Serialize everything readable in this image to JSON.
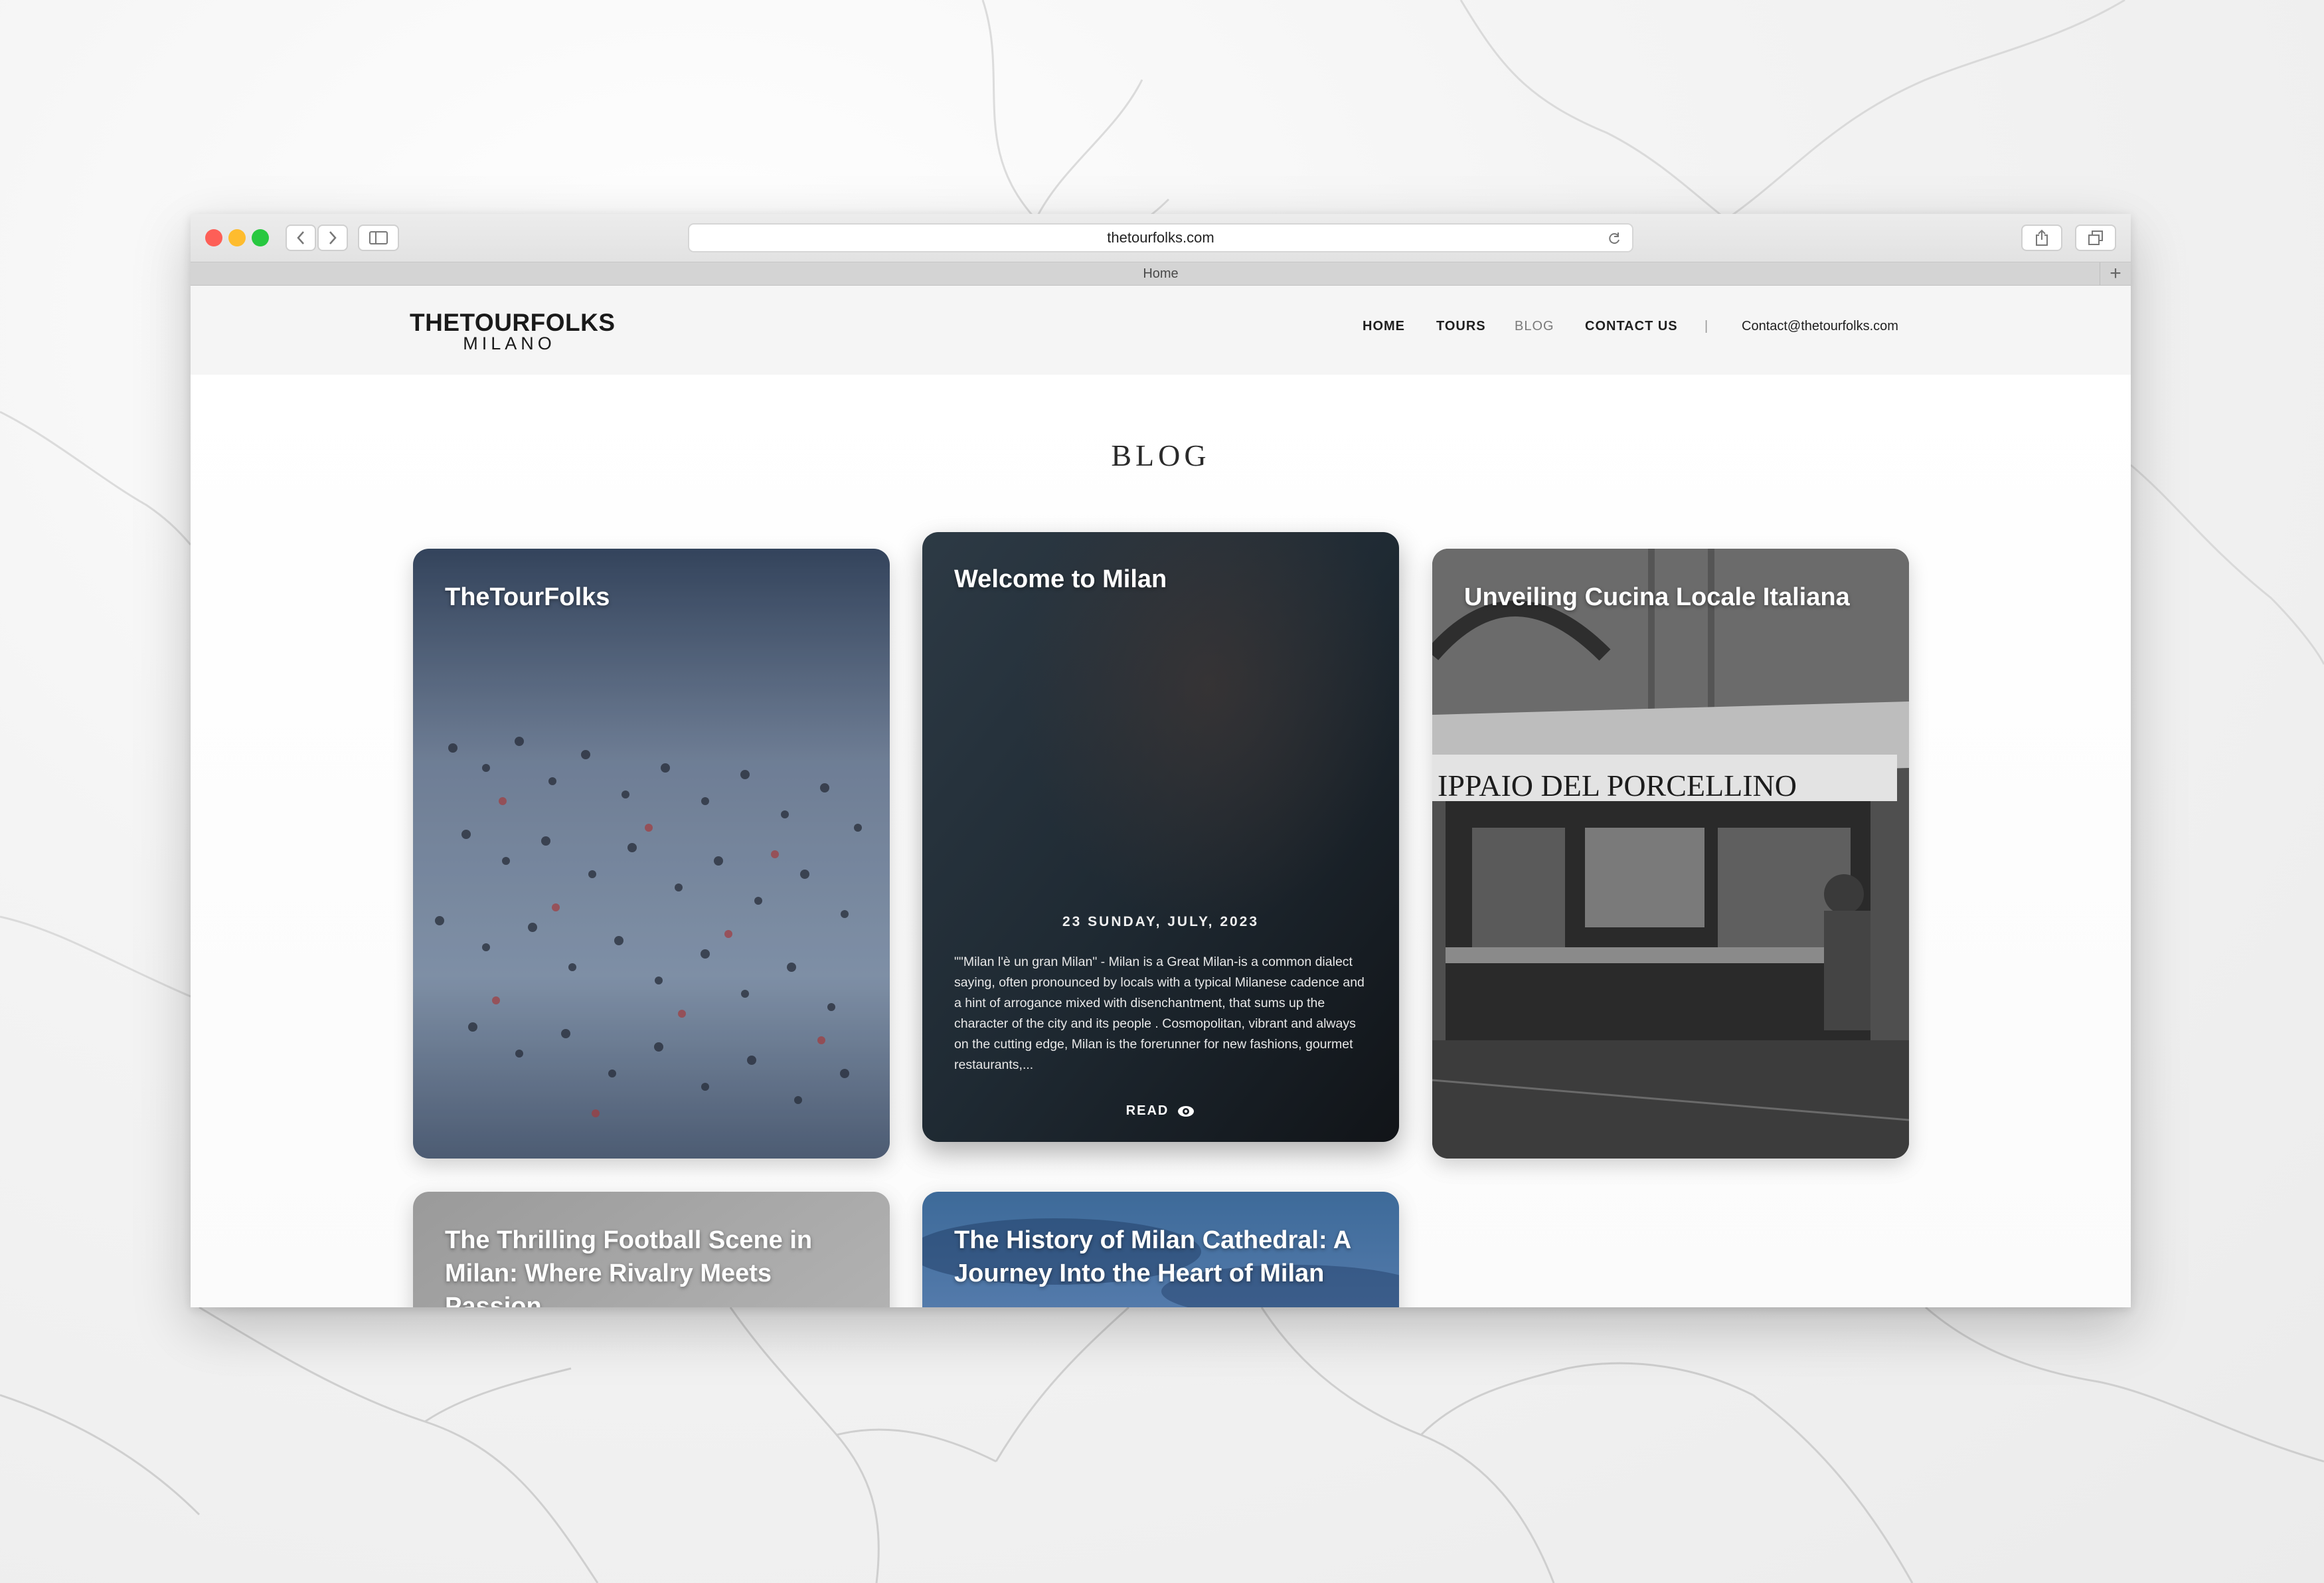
{
  "browser": {
    "url": "thetourfolks.com",
    "tab_title": "Home"
  },
  "site": {
    "logo_main": "THETOURFOLKS",
    "logo_sub": "MILANO",
    "nav": {
      "home": "HOME",
      "tours": "TOURS",
      "blog": "BLOG",
      "contact": "CONTACT US",
      "separator": "|",
      "email": "Contact@thetourfolks.com"
    },
    "active_nav": "blog"
  },
  "page": {
    "title": "BLOG"
  },
  "posts": [
    {
      "title": "TheTourFolks"
    },
    {
      "title": "Welcome to Milan",
      "date": "23 SUNDAY, JULY, 2023",
      "excerpt": "\"\"Milan l'è un gran Milan\" - Milan is a Great Milan-is a common dialect saying, often pronounced by locals with a typical Milanese cadence and a hint of arrogance mixed with disenchantment, that sums up the character of the city and its people . Cosmopolitan, vibrant and always on the cutting edge, Milan is the forerunner for new fashions, gourmet restaurants,...",
      "read_label": "READ"
    },
    {
      "title": "Unveiling Cucina Locale Italiana",
      "sign_text": "IPPAIO DEL PORCELLINO"
    },
    {
      "title": "The Thrilling Football Scene in Milan: Where Rivalry Meets Passion"
    },
    {
      "title": "The History of Milan Cathedral: A Journey Into the Heart of Milan"
    }
  ],
  "colors": {
    "traffic_red": "#fd5f57",
    "traffic_yellow": "#febc2e",
    "traffic_green": "#28c840",
    "header_bg": "#f5f5f5",
    "nav_inactive": "#7a7a7a"
  }
}
